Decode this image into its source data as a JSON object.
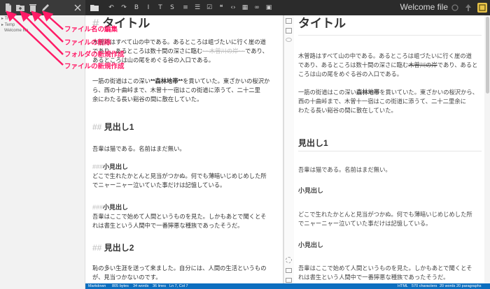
{
  "app": {
    "doc_title": "Welcome file",
    "accent": "#0d6ebf",
    "annotation_color": "#ff1a66"
  },
  "explorer_toolbar": [
    {
      "name": "new-file-icon"
    },
    {
      "name": "new-folder-icon"
    },
    {
      "name": "delete-icon"
    },
    {
      "name": "rename-icon"
    }
  ],
  "editor_toolbar_icons": [
    "undo-icon",
    "redo-icon",
    "bold-icon",
    "italic-icon",
    "heading-icon",
    "strikethrough-icon",
    "unordered-list-icon",
    "ordered-list-icon",
    "checklist-icon",
    "quote-icon",
    "code-icon",
    "table-icon",
    "link-icon",
    "image-icon"
  ],
  "tree": {
    "item1": "Tr",
    "item2": "Temp",
    "item3": "Welcome file"
  },
  "annotations": {
    "rename": "ファイル名の編集",
    "delete": "ファイルの削除",
    "new_folder": "フォルダの新規作成",
    "new_file": "ファイルの新規作成"
  },
  "editor": {
    "h1_mark": "#",
    "h1": "タイトル",
    "p1_l1": "木曽路はすべて山の中である。あるところは岨づたいに行く崖の道",
    "p1_l2a": "であり、あるところは数十間の深さに臨む",
    "p1_l2b": "~~木曽川の岸~~",
    "p1_l2c": "であり、",
    "p1_l3": "あるところは山の尾をめぐる谷の入口である。",
    "p2_l1a": "一筋の街道はこの深い",
    "p2_l1b": "**森林地帯**",
    "p2_l1c": "を貫いていた。東ざかいの桜沢か",
    "p2_l2": "ら、西の十曲峠まで、木曽十一宿はこの街道に添うて、二十二里",
    "p2_l3": "余にわたる長い谿谷の間に散在していた。",
    "h2_mark": "##",
    "h2a": "見出し1",
    "p3": "吾輩は猫である。名前はまだ無い。",
    "h3_mark": "###",
    "h3a": "小見出し",
    "p4_l1": "どこで生れたかとんと見当がつかぬ。何でも薄暗いじめじめした所",
    "p4_l2": "でニャーニャー泣いていた事だけは記憶している。",
    "h3b": "小見出し",
    "p5_l1": "吾輩はここで始めて人間というものを見た。しかもあとで聞くとそ",
    "p5_l2": "れは書生という人間中で一番獰悪な種族であったそうだ。",
    "h2b": "見出し2",
    "p6_l1": "恥の多い生涯を送って来ました。自分には、人間の生活というもの",
    "p6_l2": "が、見当つかないのです。"
  },
  "preview": {
    "h1": "タイトル",
    "p1_l1": "木曽路はすべて山の中である。あるところは岨づたいに行く崖の道",
    "p1_l2a": "であり、あるところは数十間の深さに臨む",
    "p1_l2b": "木曽川の岸",
    "p1_l2c": "であり、あると",
    "p1_l3": "ころは山の尾をめぐる谷の入口である。",
    "p2_l1a": "一筋の街道はこの深い",
    "p2_l1b": "森林地帯",
    "p2_l1c": "を貫いていた。東ざかいの桜沢から、",
    "p2_l2": "西の十曲峠まで、木曽十一宿はこの街道に添うて、二十二里余に",
    "p2_l3": "わたる長い谿谷の間に散在していた。",
    "h2a": "見出し1",
    "p3": "吾輩は猫である。名前はまだ無い。",
    "h3a": "小見出し",
    "p4_l1": "どこで生れたかとんと見当がつかぬ。何でも薄暗いじめじめした所",
    "p4_l2": "でニャーニャー泣いていた事だけは記憶している。",
    "h3b": "小見出し",
    "p5_l1": "吾輩はここで始めて人間というものを見た。しかもあとで聞くとそ",
    "p5_l2": "れは書生という人間中で一番獰悪な種族であったそうだ。"
  },
  "status": {
    "mode": "Markdown",
    "bytes": "805 bytes",
    "words": "34 words",
    "lines": "36 lines",
    "pos": "Ln 7, Col 7",
    "html": "HTML",
    "chars": "570 characters",
    "pwords": "20 words",
    "paras": "20 paragraphs"
  }
}
